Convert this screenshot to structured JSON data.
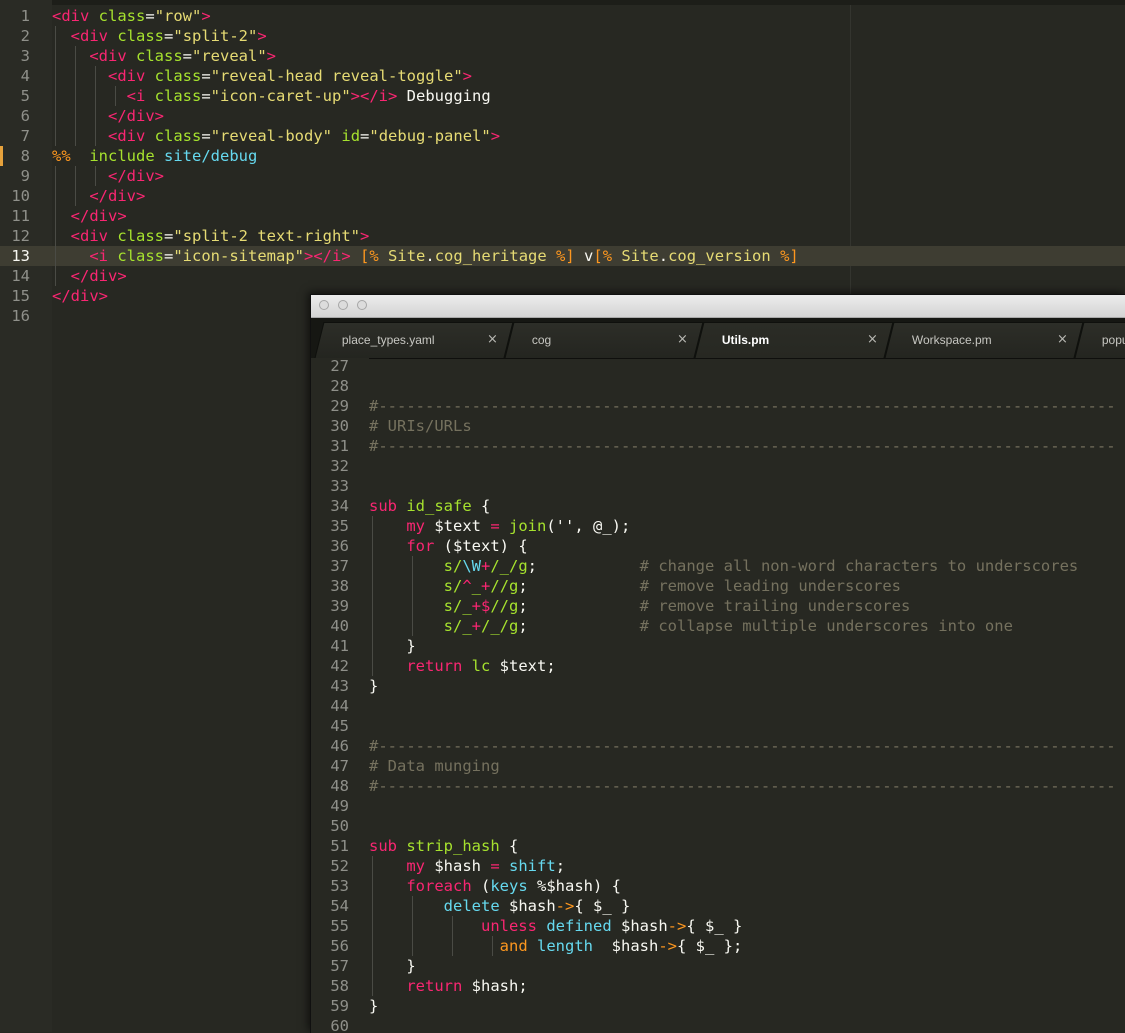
{
  "back_editor": {
    "current_line": 13,
    "lines": [
      {
        "n": "1",
        "guides": 0,
        "tokens": [
          [
            "tag",
            "<div "
          ],
          [
            "attr",
            "class"
          ],
          [
            "plain",
            "="
          ],
          [
            "str",
            "\"row\""
          ],
          [
            "tag",
            ">"
          ]
        ]
      },
      {
        "n": "2",
        "guides": 1,
        "tokens": [
          [
            "plain",
            "  "
          ],
          [
            "tag",
            "<div "
          ],
          [
            "attr",
            "class"
          ],
          [
            "plain",
            "="
          ],
          [
            "str",
            "\"split-2\""
          ],
          [
            "tag",
            ">"
          ]
        ]
      },
      {
        "n": "3",
        "guides": 2,
        "tokens": [
          [
            "plain",
            "    "
          ],
          [
            "tag",
            "<div "
          ],
          [
            "attr",
            "class"
          ],
          [
            "plain",
            "="
          ],
          [
            "str",
            "\"reveal\""
          ],
          [
            "tag",
            ">"
          ]
        ]
      },
      {
        "n": "4",
        "guides": 3,
        "tokens": [
          [
            "plain",
            "      "
          ],
          [
            "tag",
            "<div "
          ],
          [
            "attr",
            "class"
          ],
          [
            "plain",
            "="
          ],
          [
            "str",
            "\"reveal-head reveal-toggle\""
          ],
          [
            "tag",
            ">"
          ]
        ]
      },
      {
        "n": "5",
        "guides": 4,
        "tokens": [
          [
            "plain",
            "        "
          ],
          [
            "tag",
            "<i "
          ],
          [
            "attr",
            "class"
          ],
          [
            "plain",
            "="
          ],
          [
            "str",
            "\"icon-caret-up\""
          ],
          [
            "tag",
            "></i>"
          ],
          [
            "plain",
            " Debugging"
          ]
        ]
      },
      {
        "n": "6",
        "guides": 3,
        "tokens": [
          [
            "plain",
            "      "
          ],
          [
            "tag",
            "</div>"
          ]
        ]
      },
      {
        "n": "7",
        "guides": 3,
        "tokens": [
          [
            "plain",
            "      "
          ],
          [
            "tag",
            "<div "
          ],
          [
            "attr",
            "class"
          ],
          [
            "plain",
            "="
          ],
          [
            "str",
            "\"reveal-body\""
          ],
          [
            "plain",
            " "
          ],
          [
            "attr",
            "id"
          ],
          [
            "plain",
            "="
          ],
          [
            "str",
            "\"debug-panel\""
          ],
          [
            "tag",
            ">"
          ]
        ]
      },
      {
        "n": "8",
        "guides": 0,
        "marker": true,
        "tokens": [
          [
            "tt",
            "%%"
          ],
          [
            "plain",
            "  "
          ],
          [
            "inc",
            "include"
          ],
          [
            "plain",
            " "
          ],
          [
            "path",
            "site/debug"
          ]
        ]
      },
      {
        "n": "9",
        "guides": 3,
        "tokens": [
          [
            "plain",
            "      "
          ],
          [
            "tag",
            "</div>"
          ]
        ]
      },
      {
        "n": "10",
        "guides": 2,
        "tokens": [
          [
            "plain",
            "    "
          ],
          [
            "tag",
            "</div>"
          ]
        ]
      },
      {
        "n": "11",
        "guides": 1,
        "tokens": [
          [
            "plain",
            "  "
          ],
          [
            "tag",
            "</div>"
          ]
        ]
      },
      {
        "n": "12",
        "guides": 1,
        "tokens": [
          [
            "plain",
            "  "
          ],
          [
            "tag",
            "<div "
          ],
          [
            "attr",
            "class"
          ],
          [
            "plain",
            "="
          ],
          [
            "str",
            "\"split-2 text-right\""
          ],
          [
            "tag",
            ">"
          ]
        ]
      },
      {
        "n": "13",
        "guides": 1,
        "current": true,
        "tokens": [
          [
            "plain",
            "    "
          ],
          [
            "tag",
            "<i "
          ],
          [
            "attr",
            "class"
          ],
          [
            "plain",
            "="
          ],
          [
            "str",
            "\"icon-sitemap\""
          ],
          [
            "tag",
            "></i>"
          ],
          [
            "plain",
            " "
          ],
          [
            "tt",
            "[%"
          ],
          [
            "plain",
            " "
          ],
          [
            "str",
            "Site"
          ],
          [
            "plain",
            "."
          ],
          [
            "str",
            "cog_heritage"
          ],
          [
            "plain",
            " "
          ],
          [
            "tt",
            "%]"
          ],
          [
            "plain",
            " v"
          ],
          [
            "tt",
            "[%"
          ],
          [
            "plain",
            " "
          ],
          [
            "str",
            "Site"
          ],
          [
            "plain",
            "."
          ],
          [
            "str",
            "cog_version"
          ],
          [
            "plain",
            " "
          ],
          [
            "tt",
            "%]"
          ]
        ]
      },
      {
        "n": "14",
        "guides": 1,
        "tokens": [
          [
            "plain",
            "  "
          ],
          [
            "tag",
            "</div>"
          ]
        ]
      },
      {
        "n": "15",
        "guides": 0,
        "tokens": [
          [
            "tag",
            "</div>"
          ]
        ]
      },
      {
        "n": "16",
        "guides": 0,
        "tokens": []
      }
    ]
  },
  "float_window": {
    "tabs": [
      {
        "label": "place_types.yaml",
        "close": "×",
        "active": false
      },
      {
        "label": "cog",
        "close": "×",
        "active": false
      },
      {
        "label": "Utils.pm",
        "close": "×",
        "active": true
      },
      {
        "label": "Workspace.pm",
        "close": "×",
        "active": false
      },
      {
        "label": "popu",
        "close": "",
        "active": false
      }
    ],
    "lines": [
      {
        "n": "27",
        "guides": 0,
        "tokens": []
      },
      {
        "n": "28",
        "guides": 0,
        "tokens": []
      },
      {
        "n": "29",
        "guides": 0,
        "tokens": [
          [
            "com",
            "#-------------------------------------------------------------------------------"
          ]
        ]
      },
      {
        "n": "30",
        "guides": 0,
        "tokens": [
          [
            "com",
            "# URIs/URLs"
          ]
        ]
      },
      {
        "n": "31",
        "guides": 0,
        "tokens": [
          [
            "com",
            "#-------------------------------------------------------------------------------"
          ]
        ]
      },
      {
        "n": "32",
        "guides": 0,
        "tokens": []
      },
      {
        "n": "33",
        "guides": 0,
        "tokens": []
      },
      {
        "n": "34",
        "guides": 0,
        "tokens": [
          [
            "kw",
            "sub"
          ],
          [
            "plain",
            " "
          ],
          [
            "fn",
            "id_safe"
          ],
          [
            "plain",
            " {"
          ]
        ]
      },
      {
        "n": "35",
        "guides": 1,
        "tokens": [
          [
            "plain",
            "    "
          ],
          [
            "kw",
            "my"
          ],
          [
            "plain",
            " $text "
          ],
          [
            "op",
            "="
          ],
          [
            "plain",
            " "
          ],
          [
            "fn",
            "join"
          ],
          [
            "plain",
            "('', @_);"
          ]
        ]
      },
      {
        "n": "36",
        "guides": 1,
        "tokens": [
          [
            "plain",
            "    "
          ],
          [
            "kw",
            "for"
          ],
          [
            "plain",
            " ($text) {"
          ]
        ]
      },
      {
        "n": "37",
        "guides": 2,
        "tokens": [
          [
            "plain",
            "        "
          ],
          [
            "fn",
            "s/"
          ],
          [
            "bi",
            "\\W"
          ],
          [
            "op",
            "+"
          ],
          [
            "fn",
            "/_/g"
          ],
          [
            "plain",
            ";           "
          ],
          [
            "com",
            "# change all non-word characters to underscores"
          ]
        ]
      },
      {
        "n": "38",
        "guides": 2,
        "tokens": [
          [
            "plain",
            "        "
          ],
          [
            "fn",
            "s/"
          ],
          [
            "op",
            "^"
          ],
          [
            "fn",
            "_"
          ],
          [
            "op",
            "+"
          ],
          [
            "fn",
            "//g"
          ],
          [
            "plain",
            ";            "
          ],
          [
            "com",
            "# remove leading underscores"
          ]
        ]
      },
      {
        "n": "39",
        "guides": 2,
        "tokens": [
          [
            "plain",
            "        "
          ],
          [
            "fn",
            "s/_"
          ],
          [
            "op",
            "+$"
          ],
          [
            "fn",
            "//g"
          ],
          [
            "plain",
            ";            "
          ],
          [
            "com",
            "# remove trailing underscores"
          ]
        ]
      },
      {
        "n": "40",
        "guides": 2,
        "tokens": [
          [
            "plain",
            "        "
          ],
          [
            "fn",
            "s/_"
          ],
          [
            "op",
            "+"
          ],
          [
            "fn",
            "/_/g"
          ],
          [
            "plain",
            ";            "
          ],
          [
            "com",
            "# collapse multiple underscores into one"
          ]
        ]
      },
      {
        "n": "41",
        "guides": 1,
        "tokens": [
          [
            "plain",
            "    }"
          ]
        ]
      },
      {
        "n": "42",
        "guides": 1,
        "tokens": [
          [
            "plain",
            "    "
          ],
          [
            "kw",
            "return"
          ],
          [
            "plain",
            " "
          ],
          [
            "fn",
            "lc"
          ],
          [
            "plain",
            " $text;"
          ]
        ]
      },
      {
        "n": "43",
        "guides": 0,
        "tokens": [
          [
            "plain",
            "}"
          ]
        ]
      },
      {
        "n": "44",
        "guides": 0,
        "tokens": []
      },
      {
        "n": "45",
        "guides": 0,
        "tokens": []
      },
      {
        "n": "46",
        "guides": 0,
        "tokens": [
          [
            "com",
            "#-------------------------------------------------------------------------------"
          ]
        ]
      },
      {
        "n": "47",
        "guides": 0,
        "tokens": [
          [
            "com",
            "# Data munging"
          ]
        ]
      },
      {
        "n": "48",
        "guides": 0,
        "tokens": [
          [
            "com",
            "#-------------------------------------------------------------------------------"
          ]
        ]
      },
      {
        "n": "49",
        "guides": 0,
        "tokens": []
      },
      {
        "n": "50",
        "guides": 0,
        "tokens": []
      },
      {
        "n": "51",
        "guides": 0,
        "tokens": [
          [
            "kw",
            "sub"
          ],
          [
            "plain",
            " "
          ],
          [
            "fn",
            "strip_hash"
          ],
          [
            "plain",
            " {"
          ]
        ]
      },
      {
        "n": "52",
        "guides": 1,
        "tokens": [
          [
            "plain",
            "    "
          ],
          [
            "kw",
            "my"
          ],
          [
            "plain",
            " $hash "
          ],
          [
            "op",
            "="
          ],
          [
            "plain",
            " "
          ],
          [
            "bi",
            "shift"
          ],
          [
            "plain",
            ";"
          ]
        ]
      },
      {
        "n": "53",
        "guides": 1,
        "tokens": [
          [
            "plain",
            "    "
          ],
          [
            "kw",
            "foreach"
          ],
          [
            "plain",
            " ("
          ],
          [
            "bi",
            "keys"
          ],
          [
            "plain",
            " %$hash) {"
          ]
        ]
      },
      {
        "n": "54",
        "guides": 2,
        "tokens": [
          [
            "plain",
            "        "
          ],
          [
            "bi",
            "delete"
          ],
          [
            "plain",
            " $hash"
          ],
          [
            "ora",
            "->"
          ],
          [
            "plain",
            "{ $_ }"
          ]
        ]
      },
      {
        "n": "55",
        "guides": 3,
        "tokens": [
          [
            "plain",
            "            "
          ],
          [
            "kw",
            "unless"
          ],
          [
            "plain",
            " "
          ],
          [
            "bi",
            "defined"
          ],
          [
            "plain",
            " $hash"
          ],
          [
            "ora",
            "->"
          ],
          [
            "plain",
            "{ $_ }"
          ]
        ]
      },
      {
        "n": "56",
        "guides": 4,
        "tokens": [
          [
            "plain",
            "              "
          ],
          [
            "ora",
            "and"
          ],
          [
            "plain",
            " "
          ],
          [
            "bi",
            "length"
          ],
          [
            "plain",
            "  $hash"
          ],
          [
            "ora",
            "->"
          ],
          [
            "plain",
            "{ $_ };"
          ]
        ]
      },
      {
        "n": "57",
        "guides": 1,
        "tokens": [
          [
            "plain",
            "    }"
          ]
        ]
      },
      {
        "n": "58",
        "guides": 1,
        "tokens": [
          [
            "plain",
            "    "
          ],
          [
            "kw",
            "return"
          ],
          [
            "plain",
            " $hash;"
          ]
        ]
      },
      {
        "n": "59",
        "guides": 0,
        "tokens": [
          [
            "plain",
            "}"
          ]
        ]
      },
      {
        "n": "60",
        "guides": 0,
        "tokens": []
      }
    ]
  }
}
